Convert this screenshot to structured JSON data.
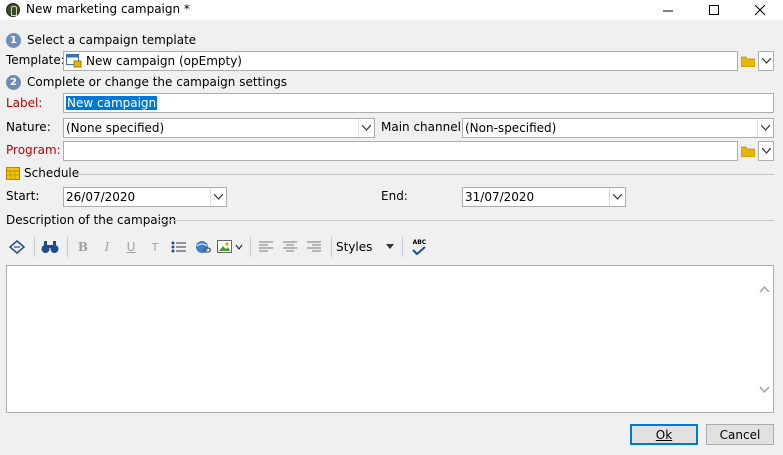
{
  "window": {
    "title": "New marketing campaign *",
    "minimize_symbol": "—",
    "maximize_symbol": "☐",
    "close_symbol": "✕"
  },
  "step1": {
    "number": "1",
    "label": "Select a campaign template"
  },
  "template": {
    "label": "Template:",
    "value": "New campaign (opEmpty)",
    "icon": "campaign-template-icon"
  },
  "step2": {
    "number": "2",
    "label": "Complete or change the campaign settings"
  },
  "label_field": {
    "label": "Label:",
    "value": "New campaign"
  },
  "nature": {
    "label": "Nature:",
    "value": "(None specified)"
  },
  "main_channel": {
    "label": "Main channel:",
    "value": "(Non-specified)"
  },
  "program": {
    "label": "Program:",
    "value": ""
  },
  "schedule": {
    "label": "Schedule",
    "icon": "calendar-icon"
  },
  "start": {
    "label": "Start:",
    "value": "26/07/2020"
  },
  "end": {
    "label": "End:",
    "value": "31/07/2020"
  },
  "description": {
    "label": "Description of the campaign"
  },
  "toolbar": {
    "bold": "B",
    "italic": "I",
    "underline": "U",
    "strike": "T",
    "styles_label": "Styles",
    "spell_label": "ABC"
  },
  "buttons": {
    "ok": "Ok",
    "cancel": "Cancel"
  },
  "colors": {
    "required_label": "#c00000",
    "step_badge": "#6f8db9",
    "selection": "#0078d7",
    "folder": "#e8b800"
  }
}
